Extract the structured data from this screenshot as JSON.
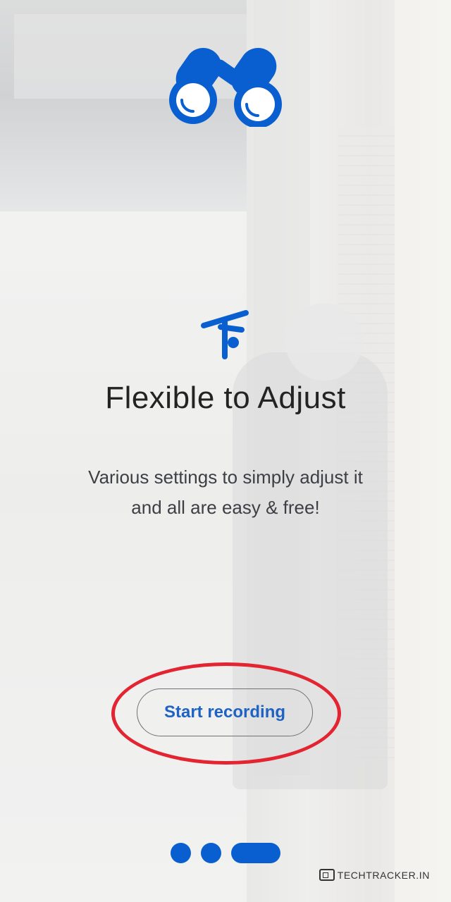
{
  "onboarding": {
    "title": "Flexible to Adjust",
    "description_line1": "Various settings to simply adjust it",
    "description_line2": "and all are easy & free!",
    "start_button_label": "Start recording",
    "feature_icon": "flexible-person-icon",
    "app_logo_icon": "binoculars-icon",
    "pager": {
      "total_pages": 3,
      "active_page": 3
    }
  },
  "watermark": {
    "text": "TechTracker.in",
    "icon": "browser-window-icon"
  },
  "colors": {
    "accent": "#0a5fd0",
    "annotation": "#e32431",
    "title_text": "#232323",
    "body_text": "#3d3f45"
  }
}
